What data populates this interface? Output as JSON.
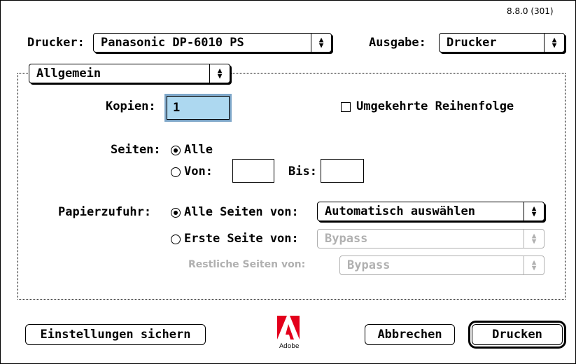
{
  "version": "8.8.0 (301)",
  "printer": {
    "label": "Drucker:",
    "value": "Panasonic DP-6010 PS"
  },
  "output": {
    "label": "Ausgabe:",
    "value": "Drucker"
  },
  "section_popup": "Allgemein",
  "copies": {
    "label": "Kopien:",
    "value": "1"
  },
  "reverse_order": {
    "label": "Umgekehrte Reihenfolge",
    "checked": false
  },
  "pages": {
    "label": "Seiten:",
    "all_label": "Alle",
    "from_label": "Von:",
    "to_label": "Bis:",
    "from_value": "",
    "to_value": ""
  },
  "paper": {
    "label": "Papierzufuhr:",
    "all_pages_label": "Alle Seiten von:",
    "all_pages_value": "Automatisch auswählen",
    "first_page_label": "Erste Seite von:",
    "first_page_value": "Bypass",
    "remaining_label": "Restliche Seiten von:",
    "remaining_value": "Bypass"
  },
  "buttons": {
    "save": "Einstellungen sichern",
    "cancel": "Abbrechen",
    "print": "Drucken"
  },
  "logo": {
    "text": "Adobe",
    "symbol": "A"
  },
  "icons": {
    "popup_arrows": "updown-arrows-icon"
  }
}
